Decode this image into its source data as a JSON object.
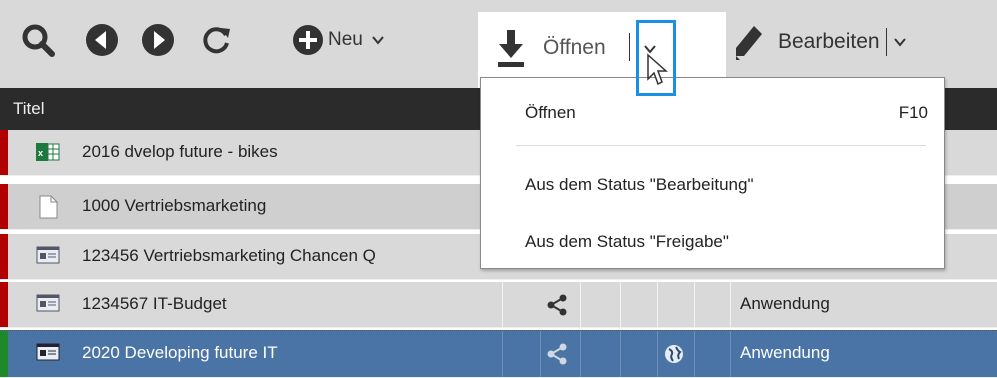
{
  "toolbar": {
    "new_label": "Neu",
    "open_label": "Öffnen",
    "edit_label": "Bearbeiten"
  },
  "grid": {
    "column_title": "Titel",
    "rows": [
      {
        "title": "2016  dvelop future - bikes",
        "icon": "excel-icon",
        "type": ""
      },
      {
        "title": "1000  Vertriebsmarketing",
        "icon": "document-icon",
        "type": ""
      },
      {
        "title": "123456  Vertriebsmarketing Chancen Q",
        "icon": "application-icon",
        "type": ""
      },
      {
        "title": "1234567  IT-Budget",
        "icon": "application-icon",
        "type": "Anwendung"
      },
      {
        "title": "2020  Developing future IT",
        "icon": "application-icon",
        "type": "Anwendung"
      }
    ]
  },
  "menu": {
    "items": [
      {
        "label": "Öffnen",
        "shortcut": "F10"
      },
      {
        "label": "Aus dem Status \"Bearbeitung\""
      },
      {
        "label": "Aus dem Status \"Freigabe\""
      }
    ]
  },
  "colors": {
    "toolbar_bg": "#d9d9d9",
    "header_bg": "#2b2b2b",
    "row_marker": "#b10000",
    "selection": "#4a74a5",
    "focus_outline": "#1a8fe6"
  }
}
